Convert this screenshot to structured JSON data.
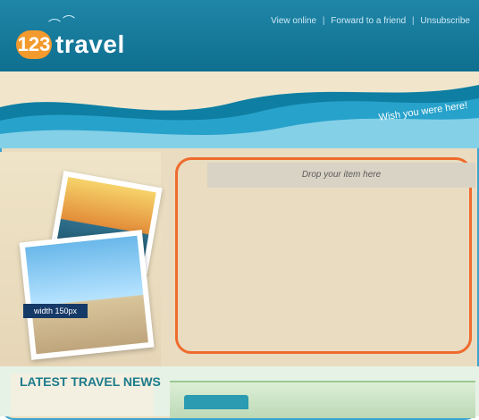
{
  "header": {
    "logo_number": "123",
    "logo_word": "travel",
    "links": [
      "View online",
      "Forward to a friend",
      "Unsubscribe"
    ]
  },
  "banner": {
    "tagline": "Wish you were here!"
  },
  "left_panel": {
    "width_label": "width 150px"
  },
  "main": {
    "drop_text": "Drop your item here"
  },
  "bottom": {
    "latest_title": "LATEST TRAVEL NEWS"
  }
}
